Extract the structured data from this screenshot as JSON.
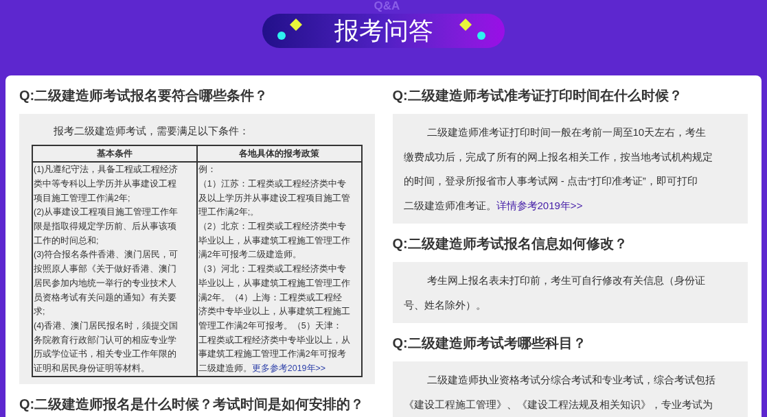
{
  "banner": {
    "watermark": "Q&A",
    "title": "报考问答"
  },
  "left": [
    {
      "question": "Q:二级建造师考试报名要符合哪些条件？",
      "answer": {
        "kind": "table",
        "intro": "报考二级建造师考试，需要满足以下条件：",
        "columns": [
          "基本条件",
          "各地具体的报考政策"
        ],
        "cells": [
          {
            "lines": [
              "(1)凡遵纪守法，具备工程或工程经济",
              "类中等专科以上学历并从事建设工程",
              "项目施工管理工作满2年;",
              "(2)从事建设工程项目施工管理工作年",
              "限是指取得规定学历前、后从事该项",
              "工作的时间总和;",
              "(3)符合报名条件香港、澳门居民，可",
              "按照原人事部《关于做好香港、澳门",
              "居民参加内地统一举行的专业技术人",
              "员资格考试有关问题的通知》有关要",
              "求;",
              "(4)香港、澳门居民报名时，须提交国",
              "务院教育行政部门认可的相应专业学",
              "历或学位证书，相关专业工作年限的",
              "证明和居民身份证明等材料。"
            ]
          },
          {
            "lines": [
              "例：",
              "（1）江苏：工程类或工程经济类中专",
              "及以上学历并从事建设工程项目施工管",
              "理工作满2年;。",
              "（2）北京：工程类或工程经济类中专",
              "毕业以上，从事建筑工程施工管理工作",
              "满2年可报考二级建造师。",
              "（3）河北：工程类或工程经济类中专",
              "毕业以上，从事建筑工程施工管理工作",
              "满2年。（4）上海：工程类或工程经",
              "济类中专毕业以上，从事建筑工程施工",
              "管理工作满2年可报考。（5）天津：",
              "工程类或工程经济类中专毕业以上，从",
              "事建筑工程施工管理工作满2年可报考",
              "二级建造师。"
            ],
            "link": "更多参考2019年>>"
          }
        ]
      }
    },
    {
      "question": "Q:二级建造师报名是什么时候？考试时间是如何安排的？"
    }
  ],
  "right": [
    {
      "question": "Q:二级建造师考试准考证打印时间在什么时候？",
      "answer": {
        "kind": "text",
        "lines": [
          "二级建造师准考证打印时间一般在考前一周至10天左右，考生",
          "缴费成功后，完成了所有的网上报名相关工作，按当地考试机构规定",
          "的时间，登录所报省市人事考试网 - 点击“打印准考证”，即可打印",
          "二级建造师准考证。"
        ],
        "link": "详情参考2019年>>"
      }
    },
    {
      "question": "Q:二级建造师考试报名信息如何修改？",
      "answer": {
        "kind": "text",
        "lines": [
          "考生网上报名表未打印前，考生可自行修改有关信息（身份证",
          "号、姓名除外）。"
        ]
      }
    },
    {
      "question": "Q:二级建造师考试考哪些科目？",
      "answer": {
        "kind": "text",
        "lines": [
          "二级建造师执业资格考试分综合考试和专业考试，综合考试包括",
          "《建设工程施工管理》、《建设工程法规及相关知识》，专业考试为"
        ]
      }
    }
  ]
}
